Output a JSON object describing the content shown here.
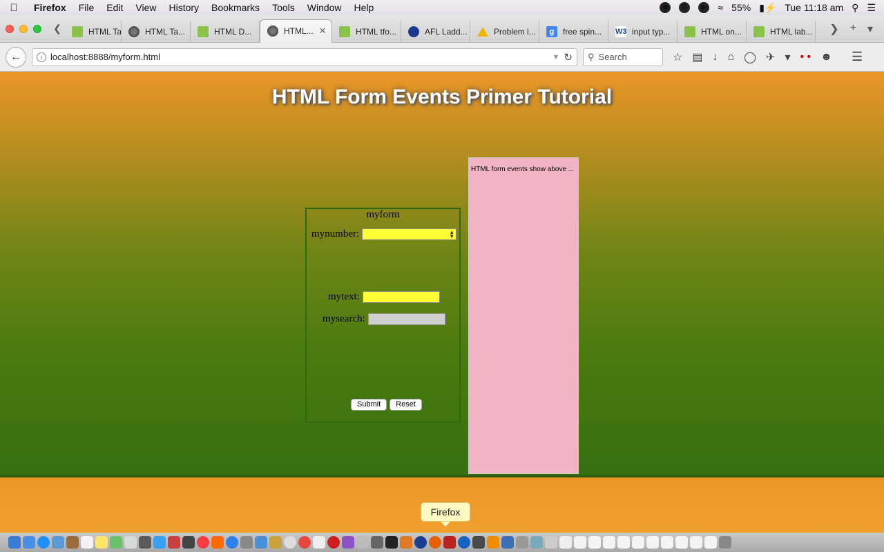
{
  "menubar": {
    "app_name": "Firefox",
    "items": [
      "File",
      "Edit",
      "View",
      "History",
      "Bookmarks",
      "Tools",
      "Window",
      "Help"
    ],
    "battery": "55%",
    "clock": "Tue 11:18 am"
  },
  "tabs": [
    {
      "title": "HTML Ta...",
      "icon": "w3-icon"
    },
    {
      "title": "HTML Ta...",
      "icon": "globe-icon"
    },
    {
      "title": "HTML D...",
      "icon": "w3-icon"
    },
    {
      "title": "HTML...",
      "icon": "globe-icon",
      "active": true
    },
    {
      "title": "HTML tfo...",
      "icon": "w3-icon"
    },
    {
      "title": "AFL Ladd...",
      "icon": "afl-icon"
    },
    {
      "title": "Problem l...",
      "icon": "warning-icon"
    },
    {
      "title": "free spin...",
      "icon": "google-icon"
    },
    {
      "title": "input typ...",
      "icon": "w3schools-icon"
    },
    {
      "title": "HTML on...",
      "icon": "w3-icon"
    },
    {
      "title": "HTML lab...",
      "icon": "w3-icon"
    }
  ],
  "navbar": {
    "url": "localhost:8888/myform.html",
    "search_placeholder": "Search"
  },
  "page": {
    "title": "HTML Form Events Primer Tutorial",
    "form": {
      "legend": "myform",
      "mynumber_label": "mynumber:",
      "mytext_label": "mytext:",
      "mysearch_label": "mysearch:",
      "submit_label": "Submit",
      "reset_label": "Reset"
    },
    "events_text": "HTML form events show above ..."
  },
  "dock": {
    "tooltip": "Firefox"
  }
}
